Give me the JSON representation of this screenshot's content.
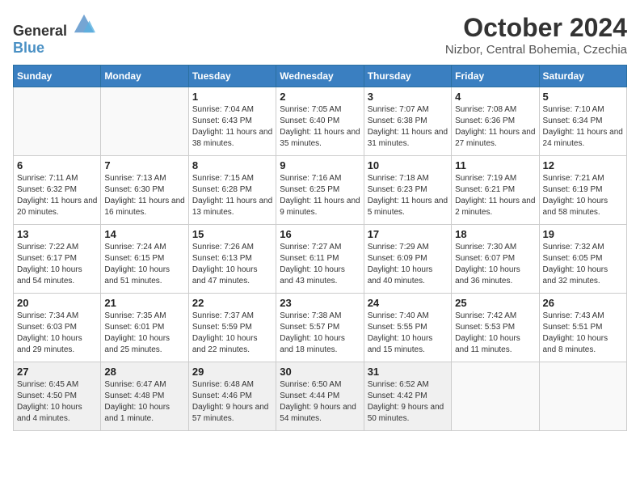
{
  "header": {
    "logo": {
      "text_general": "General",
      "text_blue": "Blue"
    },
    "title": "October 2024",
    "location": "Nizbor, Central Bohemia, Czechia"
  },
  "days_of_week": [
    "Sunday",
    "Monday",
    "Tuesday",
    "Wednesday",
    "Thursday",
    "Friday",
    "Saturday"
  ],
  "weeks": [
    [
      {
        "day": "",
        "info": ""
      },
      {
        "day": "",
        "info": ""
      },
      {
        "day": "1",
        "info": "Sunrise: 7:04 AM\nSunset: 6:43 PM\nDaylight: 11 hours and 38 minutes."
      },
      {
        "day": "2",
        "info": "Sunrise: 7:05 AM\nSunset: 6:40 PM\nDaylight: 11 hours and 35 minutes."
      },
      {
        "day": "3",
        "info": "Sunrise: 7:07 AM\nSunset: 6:38 PM\nDaylight: 11 hours and 31 minutes."
      },
      {
        "day": "4",
        "info": "Sunrise: 7:08 AM\nSunset: 6:36 PM\nDaylight: 11 hours and 27 minutes."
      },
      {
        "day": "5",
        "info": "Sunrise: 7:10 AM\nSunset: 6:34 PM\nDaylight: 11 hours and 24 minutes."
      }
    ],
    [
      {
        "day": "6",
        "info": "Sunrise: 7:11 AM\nSunset: 6:32 PM\nDaylight: 11 hours and 20 minutes."
      },
      {
        "day": "7",
        "info": "Sunrise: 7:13 AM\nSunset: 6:30 PM\nDaylight: 11 hours and 16 minutes."
      },
      {
        "day": "8",
        "info": "Sunrise: 7:15 AM\nSunset: 6:28 PM\nDaylight: 11 hours and 13 minutes."
      },
      {
        "day": "9",
        "info": "Sunrise: 7:16 AM\nSunset: 6:25 PM\nDaylight: 11 hours and 9 minutes."
      },
      {
        "day": "10",
        "info": "Sunrise: 7:18 AM\nSunset: 6:23 PM\nDaylight: 11 hours and 5 minutes."
      },
      {
        "day": "11",
        "info": "Sunrise: 7:19 AM\nSunset: 6:21 PM\nDaylight: 11 hours and 2 minutes."
      },
      {
        "day": "12",
        "info": "Sunrise: 7:21 AM\nSunset: 6:19 PM\nDaylight: 10 hours and 58 minutes."
      }
    ],
    [
      {
        "day": "13",
        "info": "Sunrise: 7:22 AM\nSunset: 6:17 PM\nDaylight: 10 hours and 54 minutes."
      },
      {
        "day": "14",
        "info": "Sunrise: 7:24 AM\nSunset: 6:15 PM\nDaylight: 10 hours and 51 minutes."
      },
      {
        "day": "15",
        "info": "Sunrise: 7:26 AM\nSunset: 6:13 PM\nDaylight: 10 hours and 47 minutes."
      },
      {
        "day": "16",
        "info": "Sunrise: 7:27 AM\nSunset: 6:11 PM\nDaylight: 10 hours and 43 minutes."
      },
      {
        "day": "17",
        "info": "Sunrise: 7:29 AM\nSunset: 6:09 PM\nDaylight: 10 hours and 40 minutes."
      },
      {
        "day": "18",
        "info": "Sunrise: 7:30 AM\nSunset: 6:07 PM\nDaylight: 10 hours and 36 minutes."
      },
      {
        "day": "19",
        "info": "Sunrise: 7:32 AM\nSunset: 6:05 PM\nDaylight: 10 hours and 32 minutes."
      }
    ],
    [
      {
        "day": "20",
        "info": "Sunrise: 7:34 AM\nSunset: 6:03 PM\nDaylight: 10 hours and 29 minutes."
      },
      {
        "day": "21",
        "info": "Sunrise: 7:35 AM\nSunset: 6:01 PM\nDaylight: 10 hours and 25 minutes."
      },
      {
        "day": "22",
        "info": "Sunrise: 7:37 AM\nSunset: 5:59 PM\nDaylight: 10 hours and 22 minutes."
      },
      {
        "day": "23",
        "info": "Sunrise: 7:38 AM\nSunset: 5:57 PM\nDaylight: 10 hours and 18 minutes."
      },
      {
        "day": "24",
        "info": "Sunrise: 7:40 AM\nSunset: 5:55 PM\nDaylight: 10 hours and 15 minutes."
      },
      {
        "day": "25",
        "info": "Sunrise: 7:42 AM\nSunset: 5:53 PM\nDaylight: 10 hours and 11 minutes."
      },
      {
        "day": "26",
        "info": "Sunrise: 7:43 AM\nSunset: 5:51 PM\nDaylight: 10 hours and 8 minutes."
      }
    ],
    [
      {
        "day": "27",
        "info": "Sunrise: 6:45 AM\nSunset: 4:50 PM\nDaylight: 10 hours and 4 minutes."
      },
      {
        "day": "28",
        "info": "Sunrise: 6:47 AM\nSunset: 4:48 PM\nDaylight: 10 hours and 1 minute."
      },
      {
        "day": "29",
        "info": "Sunrise: 6:48 AM\nSunset: 4:46 PM\nDaylight: 9 hours and 57 minutes."
      },
      {
        "day": "30",
        "info": "Sunrise: 6:50 AM\nSunset: 4:44 PM\nDaylight: 9 hours and 54 minutes."
      },
      {
        "day": "31",
        "info": "Sunrise: 6:52 AM\nSunset: 4:42 PM\nDaylight: 9 hours and 50 minutes."
      },
      {
        "day": "",
        "info": ""
      },
      {
        "day": "",
        "info": ""
      }
    ]
  ]
}
